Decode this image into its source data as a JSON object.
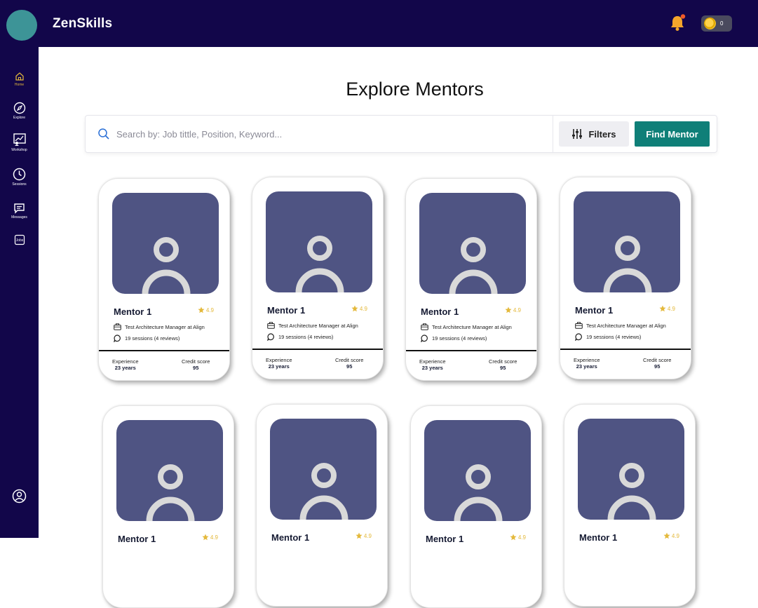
{
  "app": {
    "brand": "ZenSkills",
    "coins": "0"
  },
  "sidebar": {
    "items": [
      {
        "label": "Home",
        "icon": "home-icon",
        "active": true
      },
      {
        "label": "Explore",
        "icon": "compass-icon",
        "active": false
      },
      {
        "label": "Workshop",
        "icon": "workshop-icon",
        "active": false
      },
      {
        "label": "Sessions",
        "icon": "clock-icon",
        "active": false
      },
      {
        "label": "Messages",
        "icon": "message-icon",
        "active": false
      },
      {
        "label": "Jobs",
        "icon": "jobs-icon",
        "active": false
      }
    ],
    "profile_icon": "user-circle-icon"
  },
  "main": {
    "title": "Explore Mentors",
    "search": {
      "placeholder": "Search by: Job tittle, Position, Keyword...",
      "value": ""
    },
    "filters_label": "Filters",
    "find_label": "Find Mentor"
  },
  "mentors": [
    {
      "name": "Mentor 1",
      "rating": "4.9",
      "title": "Test Architecture Manager at Align",
      "sessions": "19 sessions (4 reviews)",
      "experience_label": "Experience",
      "experience": "23 years",
      "credit_label": "Credit score",
      "credit": "95"
    },
    {
      "name": "Mentor 1",
      "rating": "4.9",
      "title": "Test Architecture Manager at Align",
      "sessions": "19 sessions (4 reviews)",
      "experience_label": "Experience",
      "experience": "23 years",
      "credit_label": "Credit score",
      "credit": "95"
    },
    {
      "name": "Mentor 1",
      "rating": "4.9",
      "title": "Test Architecture Manager at Align",
      "sessions": "19 sessions (4 reviews)",
      "experience_label": "Experience",
      "experience": "23 years",
      "credit_label": "Credit score",
      "credit": "95"
    },
    {
      "name": "Mentor 1",
      "rating": "4.9",
      "title": "Test Architecture Manager at Align",
      "sessions": "19 sessions (4 reviews)",
      "experience_label": "Experience",
      "experience": "23 years",
      "credit_label": "Credit score",
      "credit": "95"
    },
    {
      "name": "Mentor 1",
      "rating": "4.9"
    },
    {
      "name": "Mentor 1",
      "rating": "4.9"
    },
    {
      "name": "Mentor 1",
      "rating": "4.9"
    },
    {
      "name": "Mentor 1",
      "rating": "4.9"
    }
  ],
  "colors": {
    "topbar": "#12064a",
    "accent_teal": "#0f7f78",
    "photo_bg": "#4f5483",
    "star": "#e4b93c",
    "notification_dot": "#f05a28"
  }
}
